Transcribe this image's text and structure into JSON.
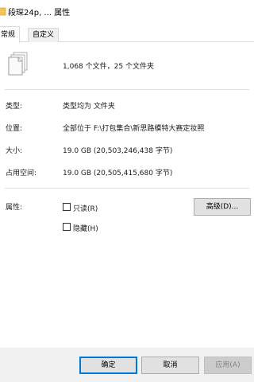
{
  "window": {
    "title": "段琛24p, ... 属性"
  },
  "tabs": [
    {
      "label": "常规",
      "active": true
    },
    {
      "label": "自定义",
      "active": false
    }
  ],
  "summary": {
    "counts": "1,068 个文件，25 个文件夹"
  },
  "properties": {
    "type": {
      "label": "类型:",
      "value": "类型均为 文件夹"
    },
    "location": {
      "label": "位置:",
      "value": "全部位于 F:\\打包集合\\新思路模特大赛定妆照"
    },
    "size": {
      "label": "大小:",
      "value": "19.0 GB (20,503,246,438 字节)"
    },
    "size_on_disk": {
      "label": "占用空间:",
      "value": "19.0 GB (20,505,415,680 字节)"
    }
  },
  "attributes": {
    "label": "属性:",
    "readonly": {
      "label": "只读(R)",
      "checked": false
    },
    "hidden": {
      "label": "隐藏(H)",
      "checked": false
    },
    "advanced_button": "高级(D)..."
  },
  "buttons": {
    "ok": "确定",
    "cancel": "取消",
    "apply": "应用(A)"
  },
  "icons": {
    "title": "folder-icon",
    "files": "multiple-files-icon"
  },
  "colors": {
    "accent": "#0078d7",
    "separator": "#e3e3e3",
    "button_face": "#e1e1e1",
    "footer": "#f0f0f0"
  }
}
